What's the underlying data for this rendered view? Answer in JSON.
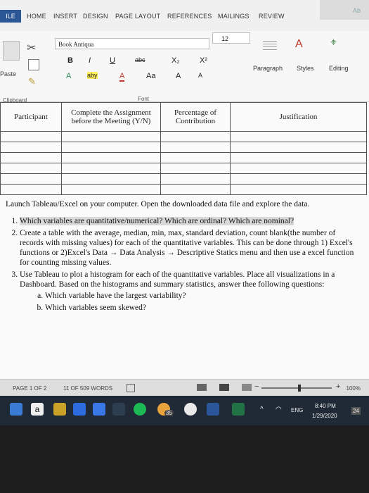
{
  "ribbon": {
    "file_tab": "ILE",
    "tabs": [
      "HOME",
      "INSERT",
      "DESIGN",
      "PAGE LAYOUT",
      "REFERENCES",
      "MAILINGS",
      "REVIEW"
    ],
    "corner_text": "Ab",
    "paste_label": "Paste",
    "clipboard_label": "Clipboard",
    "font_name": "Book Antiqua",
    "font_size": "12",
    "font_group_label": "Font",
    "format_row1": [
      "B",
      "I",
      "U",
      "abc",
      "X₂",
      "X²"
    ],
    "format_row2": [
      "A",
      "aby",
      "A",
      "Aa",
      "A",
      "A"
    ],
    "paragraph_label": "Paragraph",
    "styles_label": "Styles",
    "editing_label": "Editing"
  },
  "table": {
    "headers": [
      "Participant",
      "Complete the Assignment before the Meeting (Y/N)",
      "Percentage of Contribution",
      "Justification"
    ],
    "empty_rows": 6
  },
  "document": {
    "intro": "Launch Tableau/Excel on your computer. Open the downloaded data file and explore the data.",
    "items": [
      {
        "text": "Which variables are quantitative/numerical? Which are ordinal? Which are nominal?"
      },
      {
        "text": "Create a table with the average, median, min, max, standard deviation, count blank(the number of records with missing values) for each of the quantitative variables. This can be done through 1) Excel's functions or 2)Excel's Data → Data Analysis → Descriptive Statics menu and then use a excel function for counting missing values."
      },
      {
        "text": "Use Tableau to plot a histogram for each of the quantitative variables. Place all visualizations in a Dashboard. Based on the histograms and summary statistics, answer thee following questions:",
        "subitems": [
          "Which variable have the largest variability?",
          "Which variables seem skewed?"
        ]
      }
    ]
  },
  "status": {
    "page": "PAGE 1 OF 2",
    "words": "11 OF 509 WORDS",
    "zoom": "100%",
    "zoom_level_percent": 100
  },
  "taskbar": {
    "language": "ENG",
    "time": "8:40 PM",
    "date": "1/29/2020",
    "notification_count": "24",
    "badge_count": "35"
  }
}
